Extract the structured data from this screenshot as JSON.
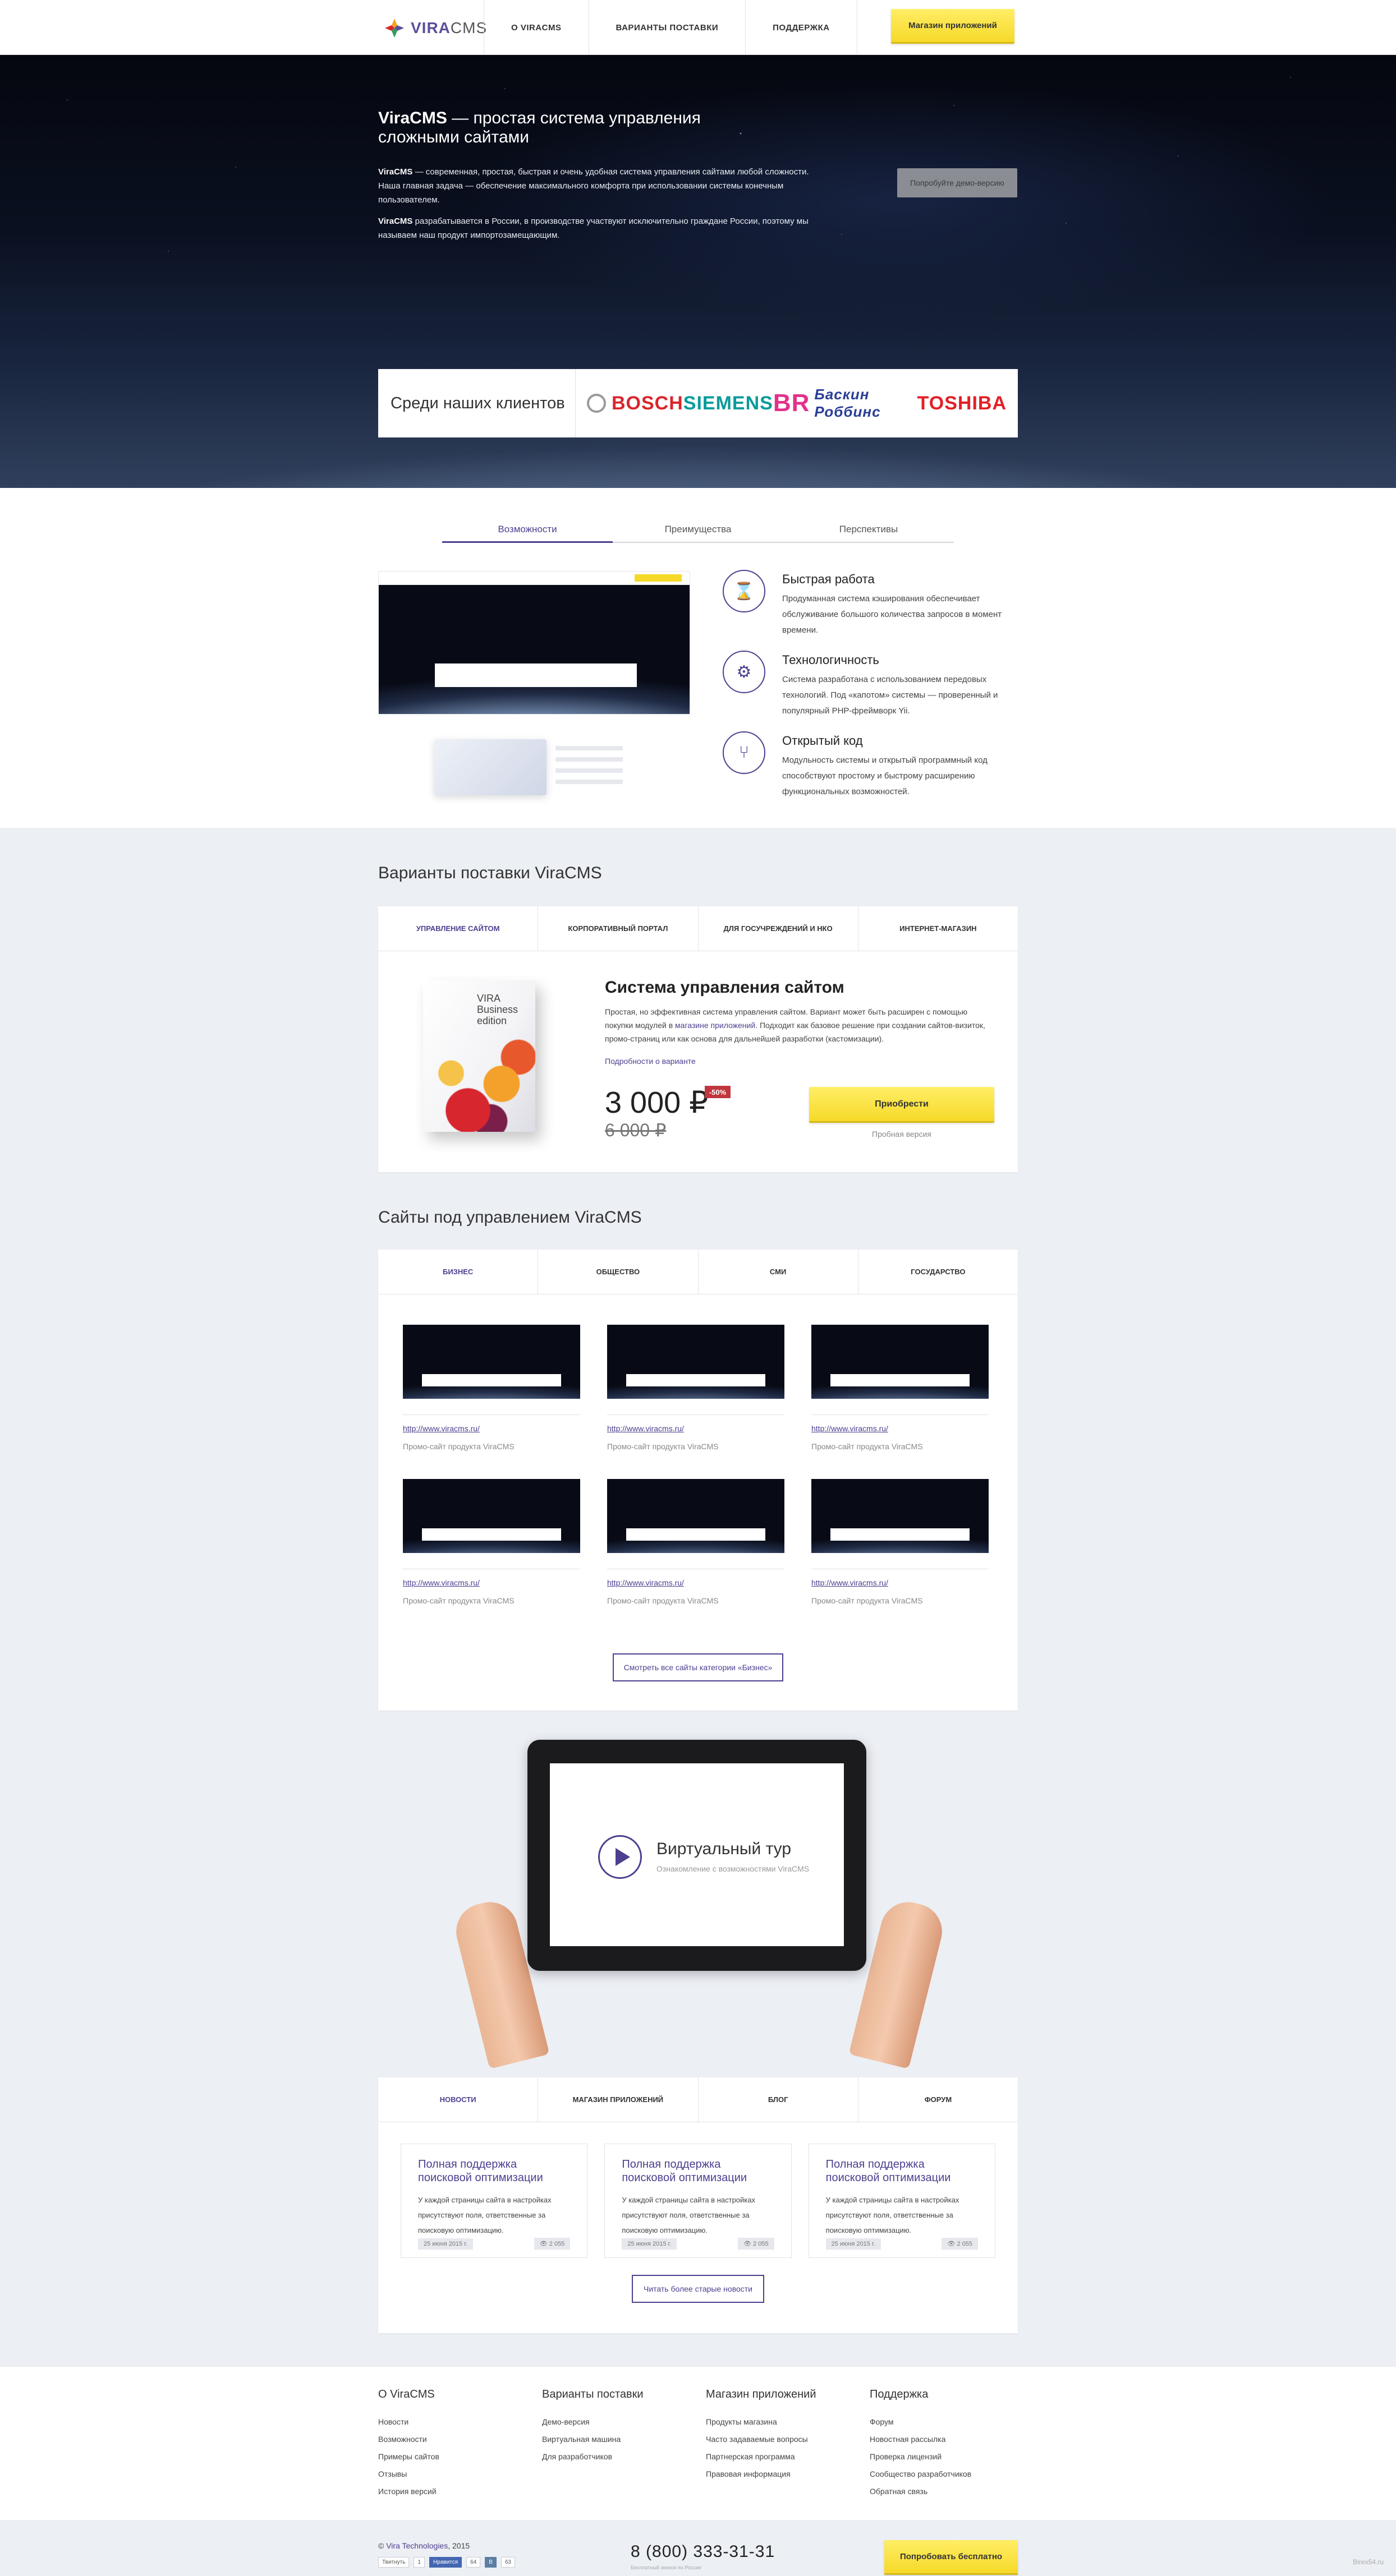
{
  "header": {
    "logo_text_a": "VIRA",
    "logo_text_b": "CMS",
    "nav": [
      "О ViraCMS",
      "Варианты поставки",
      "Поддержка"
    ],
    "apps_button": "Магазин приложений"
  },
  "hero": {
    "title_brand": "ViraCMS",
    "title_rest": " — простая система управления сложными сайтами",
    "p1_brand": "ViraCMS",
    "p1_rest": " — современная, простая, быстрая и очень удобная система управления сайтами любой сложности. Наша главная задача — обеспечение максимального комфорта при использовании системы конечным пользователем.",
    "p2_brand": "ViraCMS",
    "p2_rest": " разрабатывается в России, в производстве участвуют исключительно граждане России, поэтому мы называем наш продукт импортозамещающим.",
    "demo_button": "Попробуйте демо-версию",
    "clients_label": "Среди наших клиентов",
    "clients": [
      "BOSCH",
      "SIEMENS",
      "Баскин Роббинс",
      "TOSHIBA"
    ],
    "br_mark": "BR"
  },
  "features": {
    "tabs": [
      "Возможности",
      "Преимущества",
      "Перспективы"
    ],
    "items": [
      {
        "icon": "hourglass-icon",
        "glyph": "⌛",
        "title": "Быстрая работа",
        "text": "Продуманная система кэширования обеспечивает обслуживание большого количества запросов в момент времени."
      },
      {
        "icon": "gears-icon",
        "glyph": "⚙",
        "title": "Технологичность",
        "text": "Система разработана с использованием передовых технологий. Под «капотом» системы — проверенный и популярный PHP-фреймворк Yii."
      },
      {
        "icon": "fork-icon",
        "glyph": "⑂",
        "title": "Открытый код",
        "text": "Модульность системы и открытый программный код способствуют простому и быстрому расширению функциональных возможностей."
      }
    ]
  },
  "delivery": {
    "heading": "Варианты поставки ViraCMS",
    "tabs": [
      "Управление сайтом",
      "Корпоративный портал",
      "Для госучреждений и НКО",
      "Интернет-магазин"
    ],
    "box_brand": "VIRA",
    "box_edition": "Business edition",
    "title": "Система управления сайтом",
    "desc_a": "Простая, но эффективная система управления сайтом. Вариант может быть расширен с помощью покупки модулей в ",
    "desc_link": "магазине приложений",
    "desc_b": ". Подходит как базовое решение при создании сайтов-визиток, промо-страниц или как основа для дальнейшей разработки (кастомизации).",
    "more_link": "Подробности о варианте",
    "price": "3 000 ₽",
    "discount": "-50%",
    "old_price": "6 000 ₽",
    "buy_button": "Приобрести",
    "trial_link": "Пробная версия"
  },
  "sites": {
    "heading": "Сайты под управлением ViraCMS",
    "tabs": [
      "Бизнес",
      "Общество",
      "СМИ",
      "Государство"
    ],
    "items": [
      {
        "url": "http://www.viracms.ru/",
        "desc": "Промо-сайт продукта ViraCMS"
      },
      {
        "url": "http://www.viracms.ru/",
        "desc": "Промо-сайт продукта ViraCMS"
      },
      {
        "url": "http://www.viracms.ru/",
        "desc": "Промо-сайт продукта ViraCMS"
      },
      {
        "url": "http://www.viracms.ru/",
        "desc": "Промо-сайт продукта ViraCMS"
      },
      {
        "url": "http://www.viracms.ru/",
        "desc": "Промо-сайт продукта ViraCMS"
      },
      {
        "url": "http://www.viracms.ru/",
        "desc": "Промо-сайт продукта ViraCMS"
      }
    ],
    "all_button": "Смотреть все сайты категории «Бизнес»"
  },
  "tour": {
    "title": "Виртуальный тур",
    "subtitle": "Ознакомление с возможностями ViraCMS"
  },
  "news": {
    "tabs": [
      "Новости",
      "Магазин приложений",
      "Блог",
      "Форум"
    ],
    "items": [
      {
        "title": "Полная поддержка поисковой оптимизации",
        "text": "У каждой страницы сайта в настройках присутствуют поля, ответственные за поисковую оптимизацию.",
        "date": "25 июня 2015 г.",
        "views": "2 055"
      },
      {
        "title": "Полная поддержка поисковой оптимизации",
        "text": "У каждой страницы сайта в настройках присутствуют поля, ответственные за поисковую оптимизацию.",
        "date": "25 июня 2015 г.",
        "views": "2 055"
      },
      {
        "title": "Полная поддержка поисковой оптимизации",
        "text": "У каждой страницы сайта в настройках присутствуют поля, ответственные за поисковую оптимизацию.",
        "date": "25 июня 2015 г.",
        "views": "2 055"
      }
    ],
    "older_button": "Читать более старые новости"
  },
  "footer": {
    "cols": [
      {
        "title": "О ViraCMS",
        "links": [
          "Новости",
          "Возможности",
          "Примеры сайтов",
          "Отзывы",
          "История версий"
        ]
      },
      {
        "title": "Варианты поставки",
        "links": [
          "Демо-версия",
          "Виртуальная машина",
          "Для разработчиков"
        ]
      },
      {
        "title": "Магазин приложений",
        "links": [
          "Продукты магазина",
          "Часто задаваемые вопросы",
          "Партнерская программа",
          "Правовая информация"
        ]
      },
      {
        "title": "Поддержка",
        "links": [
          "Форум",
          "Новостная рассылка",
          "Проверка лицензий",
          "Сообщество разработчиков",
          "Обратная связь"
        ]
      }
    ],
    "copy_pre": "© ",
    "copy_link": "Vira Technologies",
    "copy_post": ", 2015",
    "socials": [
      {
        "label": "Твитнуть",
        "count": "1",
        "kind": "tw"
      },
      {
        "label": "Нравится",
        "count": "64",
        "kind": "fb"
      },
      {
        "label": "В",
        "count": "63",
        "kind": "vk"
      }
    ],
    "phone": "8 (800) 333-31-31",
    "phone_sub": "Бесплатный звонок по России",
    "try_button": "Попробовать бесплатно",
    "credit": "Birex54.ru"
  },
  "colors": {
    "accent": "#4d3f8f",
    "yellow": "#f6d928",
    "grey_bg": "#eceff4"
  }
}
